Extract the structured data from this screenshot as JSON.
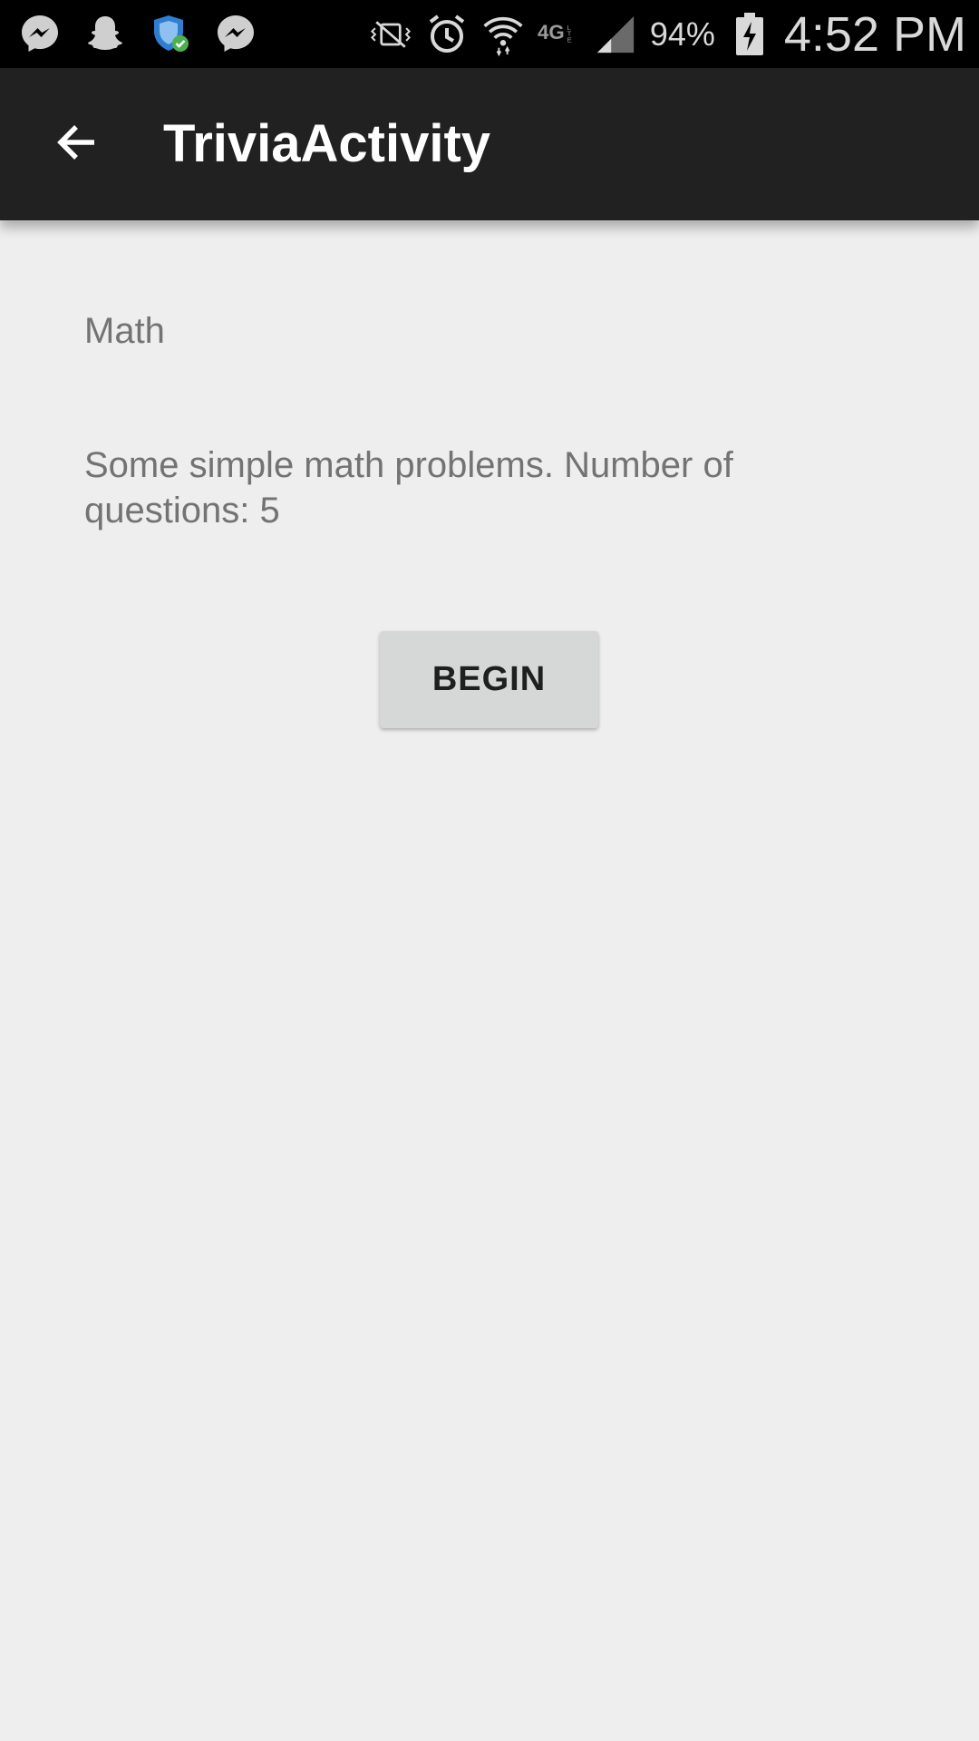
{
  "status_bar": {
    "left_icons": [
      "messenger-icon",
      "snapchat-icon",
      "shield-check-icon",
      "messenger-icon"
    ],
    "right_icons": [
      "vibrate-mute-icon",
      "alarm-icon",
      "wifi-icon",
      "4g-lte-icon",
      "signal-icon",
      "battery-charging-icon"
    ],
    "battery_percent": "94%",
    "time": "4:52 PM"
  },
  "app_bar": {
    "title": "TriviaActivity",
    "back_icon": "arrow-left-icon",
    "background_color": "#212121"
  },
  "content": {
    "category_title": "Math",
    "category_description": "Some simple math problems. Number of questions: 5",
    "begin_label": "BEGIN"
  }
}
